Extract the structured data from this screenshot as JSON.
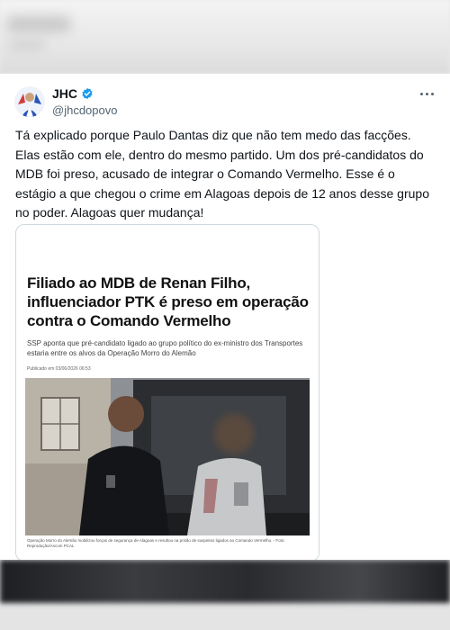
{
  "tweet": {
    "display_name": "JHC",
    "handle": "@jhcdopovo",
    "verified": true,
    "text": "Tá explicado porque Paulo Dantas diz que não tem medo das facções. Elas estão com ele, dentro do mesmo partido. Um dos pré-candidatos do MDB foi preso, acusado de integrar o Comando Vermelho. Esse é o estágio a que chegou o crime em Alagoas depois de 12 anos desse grupo no poder. Alagoas quer mudança!"
  },
  "embed": {
    "headline": "Filiado ao MDB de Renan Filho, influenciador PTK é preso em operação contra o Comando Vermelho",
    "subhead": "SSP aponta que pré-candidato ligado ao grupo político do ex-ministro dos Transportes estaria entre os alvos da Operação Morro do Alemão",
    "published": "Publicado em 03/06/2026 06:53",
    "caption": "Operação Morro do Alemão mobilizou forças de segurança de Alagoas e resultou na prisão de suspeitos ligados ao Comando Vermelho. - Foto: Reprodução/Ascom PCAL"
  },
  "colors": {
    "accent": "#1d9bf0",
    "text_primary": "#0f1419",
    "text_secondary": "#536471",
    "border": "#cfd9de"
  },
  "icons": {
    "verified": "verified-badge-icon",
    "more": "more-horizontal-icon"
  }
}
